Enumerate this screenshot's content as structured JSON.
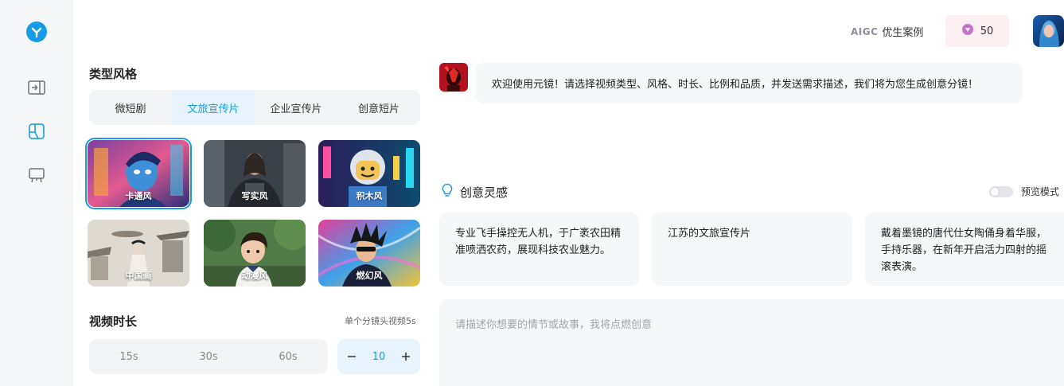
{
  "header": {
    "aigc_mark": "AIGC",
    "aigc_label": "优生案例",
    "credits": "50"
  },
  "style_section": {
    "title": "类型风格",
    "tabs": [
      {
        "label": "微短剧"
      },
      {
        "label": "文旅宣传片"
      },
      {
        "label": "企业宣传片"
      },
      {
        "label": "创意短片"
      }
    ],
    "styles": [
      {
        "label": "卡通风"
      },
      {
        "label": "写实风"
      },
      {
        "label": "积木风"
      },
      {
        "label": "中国画"
      },
      {
        "label": "动漫风"
      },
      {
        "label": "燃幻风"
      }
    ]
  },
  "duration_section": {
    "title": "视频时长",
    "note": "单个分镜头视频5s",
    "options": [
      "15s",
      "30s",
      "60s"
    ],
    "custom_value": "10"
  },
  "chat": {
    "welcome": "欢迎使用元镜！请选择视频类型、风格、时长、比例和品质，并发送需求描述，我们将为您生成创意分镜！"
  },
  "inspiration": {
    "title": "创意灵感",
    "preview_label": "预览模式",
    "ideas": [
      "专业飞手操控无人机，于广袤农田精准喷洒农药，展现科技农业魅力。",
      "江苏的文旅宣传片",
      "戴着墨镜的唐代仕女陶俑身着华服，手持乐器，在新年开启活力四射的摇滚表演。"
    ]
  },
  "prompt": {
    "placeholder": "请描述你想要的情节或故事，我将点燃创意"
  },
  "colors": {
    "accent": "#169ce6",
    "panel": "#f3f4f6",
    "active_tab_bg": "#e7f3fd"
  }
}
